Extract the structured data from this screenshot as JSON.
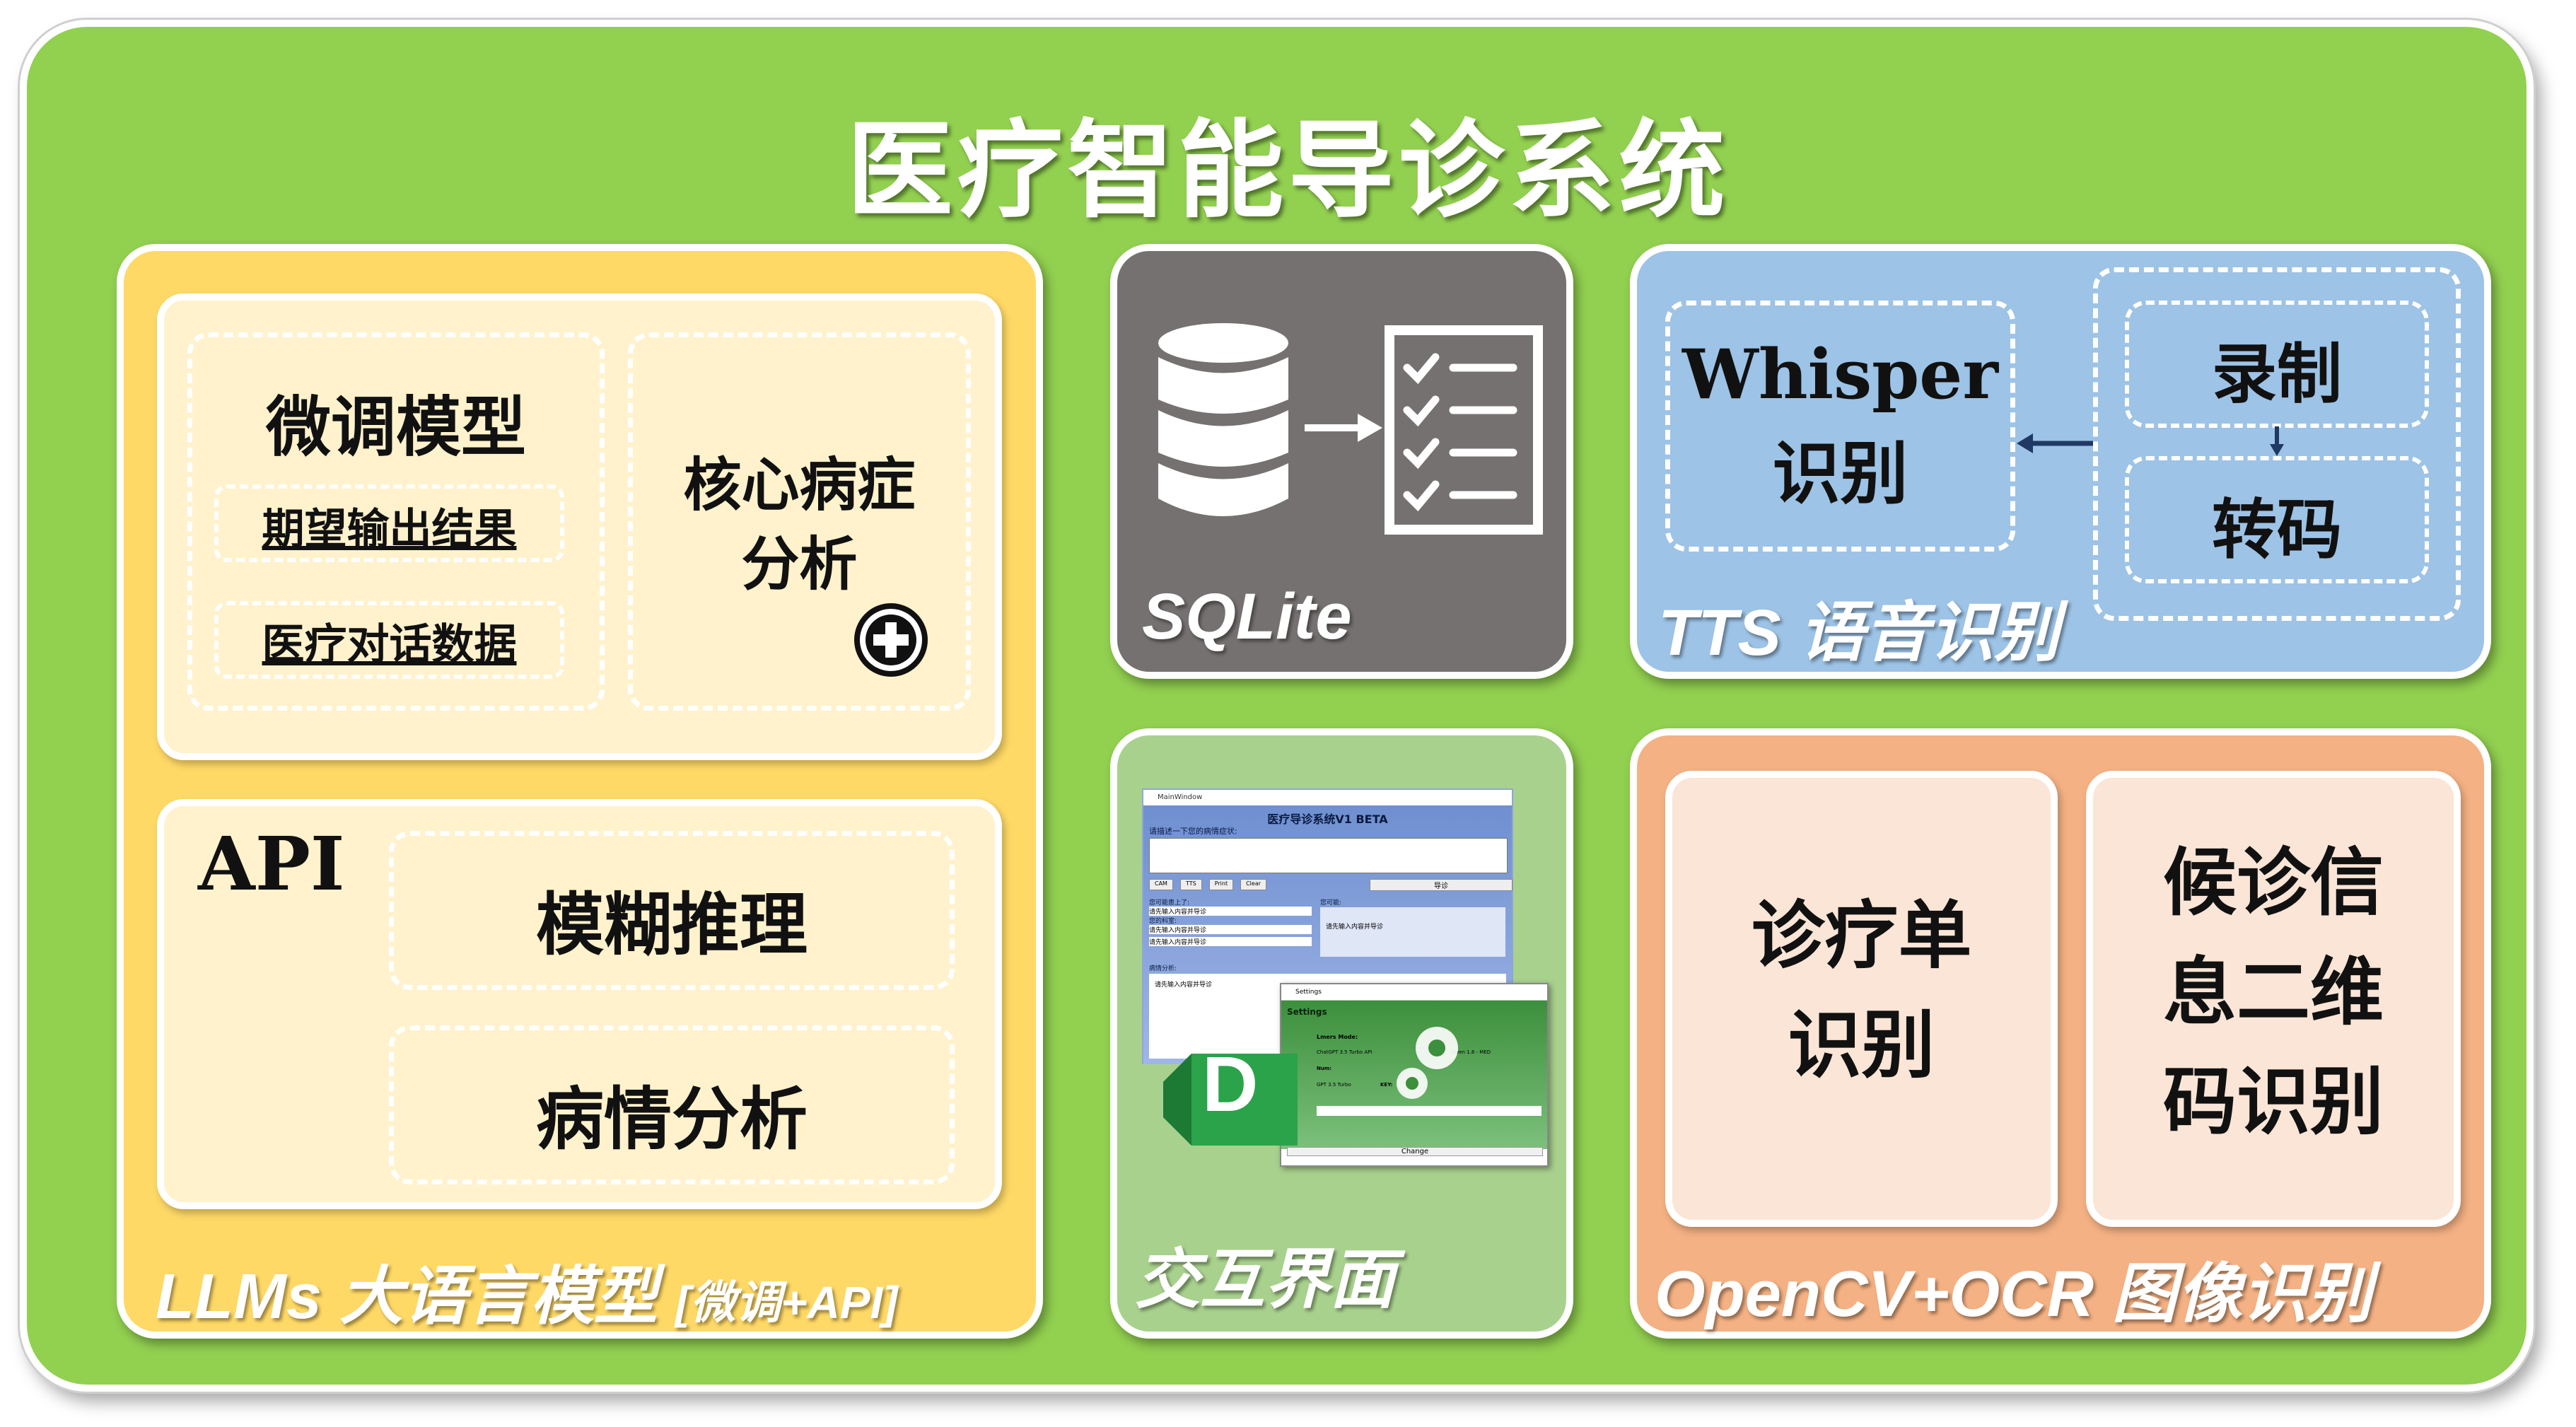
{
  "title": "医疗智能导诊系统",
  "llm": {
    "finetune_title": "微调模型",
    "expected_output": "期望输出结果",
    "dialog_data": "医疗对话数据",
    "core_analysis": "核心病症\n分析",
    "api_title": "API",
    "fuzzy": "模糊推理",
    "condition": "病情分析",
    "label_main": "LLMs 大语言模型",
    "label_sub": "[微调+API]"
  },
  "db": {
    "label": "SQLite"
  },
  "tts": {
    "whisper": "Whisper\n识别",
    "record": "录制",
    "transcode": "转码",
    "label": "TTS 语音识别"
  },
  "ui": {
    "label": "交互界面",
    "window_title": "MainWindow",
    "app_title": "医疗导诊系统V1 BETA",
    "prompt": "请描述一下您的病情症状:",
    "buttons": [
      "CAM",
      "TTS",
      "Print",
      "Clear"
    ],
    "guide_button": "导诊",
    "left_items": [
      "您可能患上了:",
      "请先输入内容并导诊",
      "您的科室:",
      "请先输入内容并导诊",
      "请先输入内容并导诊"
    ],
    "right_title": "您可能:",
    "right_text": "请先输入内容并导诊",
    "analysis_title": "病情分析:",
    "analysis_text": "请先输入内容并导诊",
    "settings_title": "Settings",
    "settings_heading": "Settings",
    "settings_rows": [
      "Lmers Mode:",
      "ChatGPT 3.5 Turbo API",
      "Qwen 1.8 - MED",
      "Num:",
      "GPT 3.5 Turbo",
      "KEY:"
    ],
    "settings_button": "Change",
    "logo_letter": "D"
  },
  "ocr": {
    "prescription": "诊疗单\n识别",
    "qrcode": "候诊信\n息二维\n码识别",
    "label": "OpenCV+OCR 图像识别"
  }
}
